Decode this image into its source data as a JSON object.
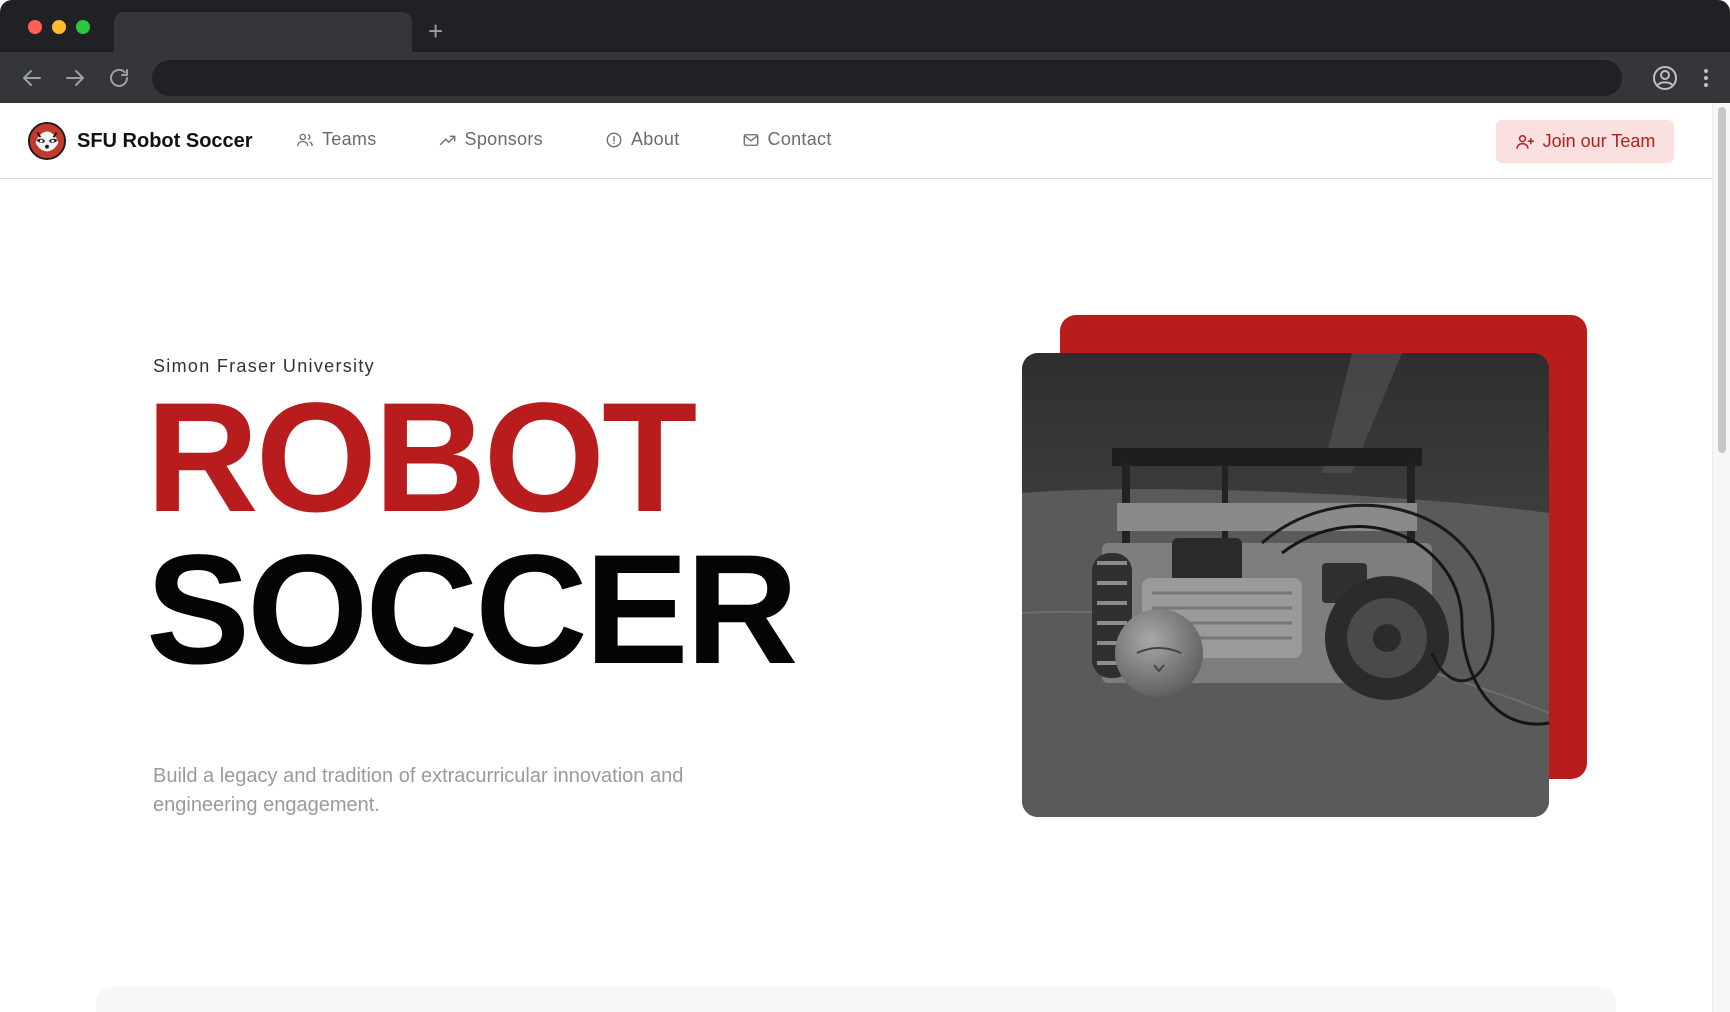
{
  "nav": {
    "brand": "SFU Robot Soccer",
    "links": [
      {
        "label": "Teams",
        "icon": "users-icon"
      },
      {
        "label": "Sponsors",
        "icon": "trending-up-icon"
      },
      {
        "label": "About",
        "icon": "info-icon"
      },
      {
        "label": "Contact",
        "icon": "mail-icon"
      }
    ],
    "cta": "Join our Team"
  },
  "hero": {
    "eyebrow": "Simon Fraser University",
    "title_line1": "ROBOT",
    "title_line2": "SOCCER",
    "tagline": "Build a legacy and tradition of extracurricular innovation and engineering engagement.",
    "photo_alt": "Robot soccer robot with golf ball"
  },
  "colors": {
    "accent": "#b91c1c",
    "accent_tint": "#fbe0e0",
    "title_dark": "#050505"
  }
}
